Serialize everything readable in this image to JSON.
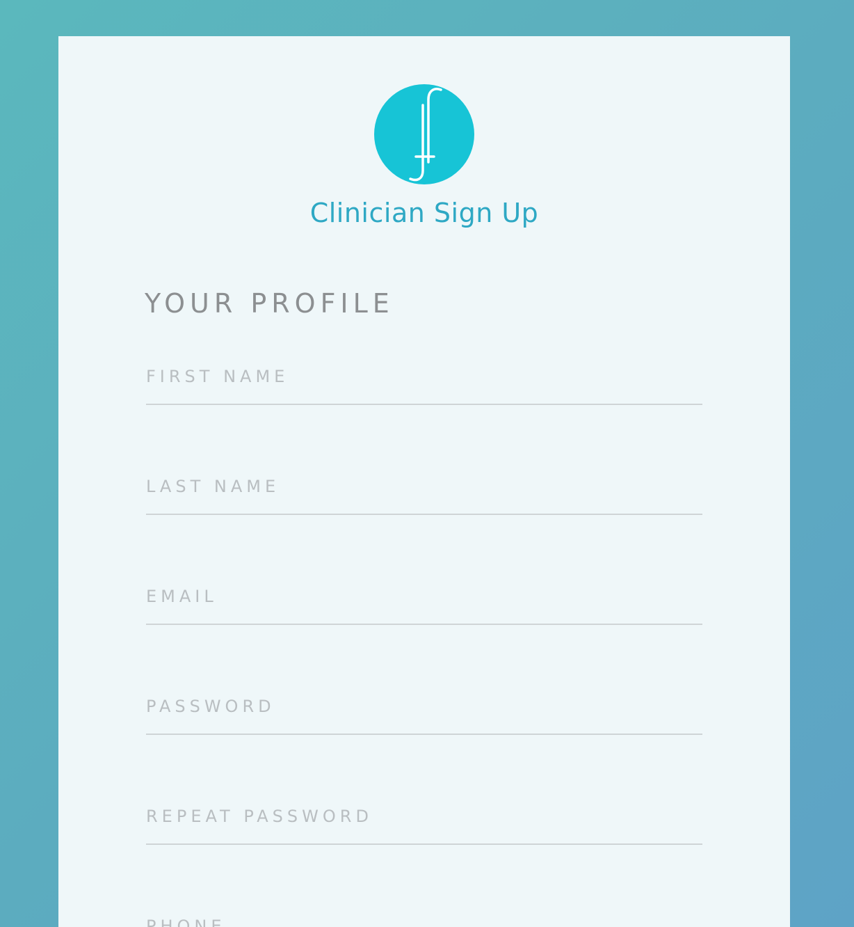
{
  "app": {
    "title": "Clinician Sign Up",
    "logo_icon": "integral-f-logo-icon",
    "colors": {
      "accent": "#17c4d6",
      "title": "#2ea8c4",
      "heading": "#8c8f91",
      "placeholder": "#b9bec1"
    }
  },
  "profile": {
    "heading": "YOUR PROFILE",
    "fields": [
      {
        "placeholder": "FIRST NAME",
        "value": ""
      },
      {
        "placeholder": "LAST NAME",
        "value": ""
      },
      {
        "placeholder": "EMAIL",
        "value": ""
      },
      {
        "placeholder": "PASSWORD",
        "value": ""
      },
      {
        "placeholder": "REPEAT PASSWORD",
        "value": ""
      },
      {
        "placeholder": "PHONE",
        "value": ""
      }
    ]
  }
}
